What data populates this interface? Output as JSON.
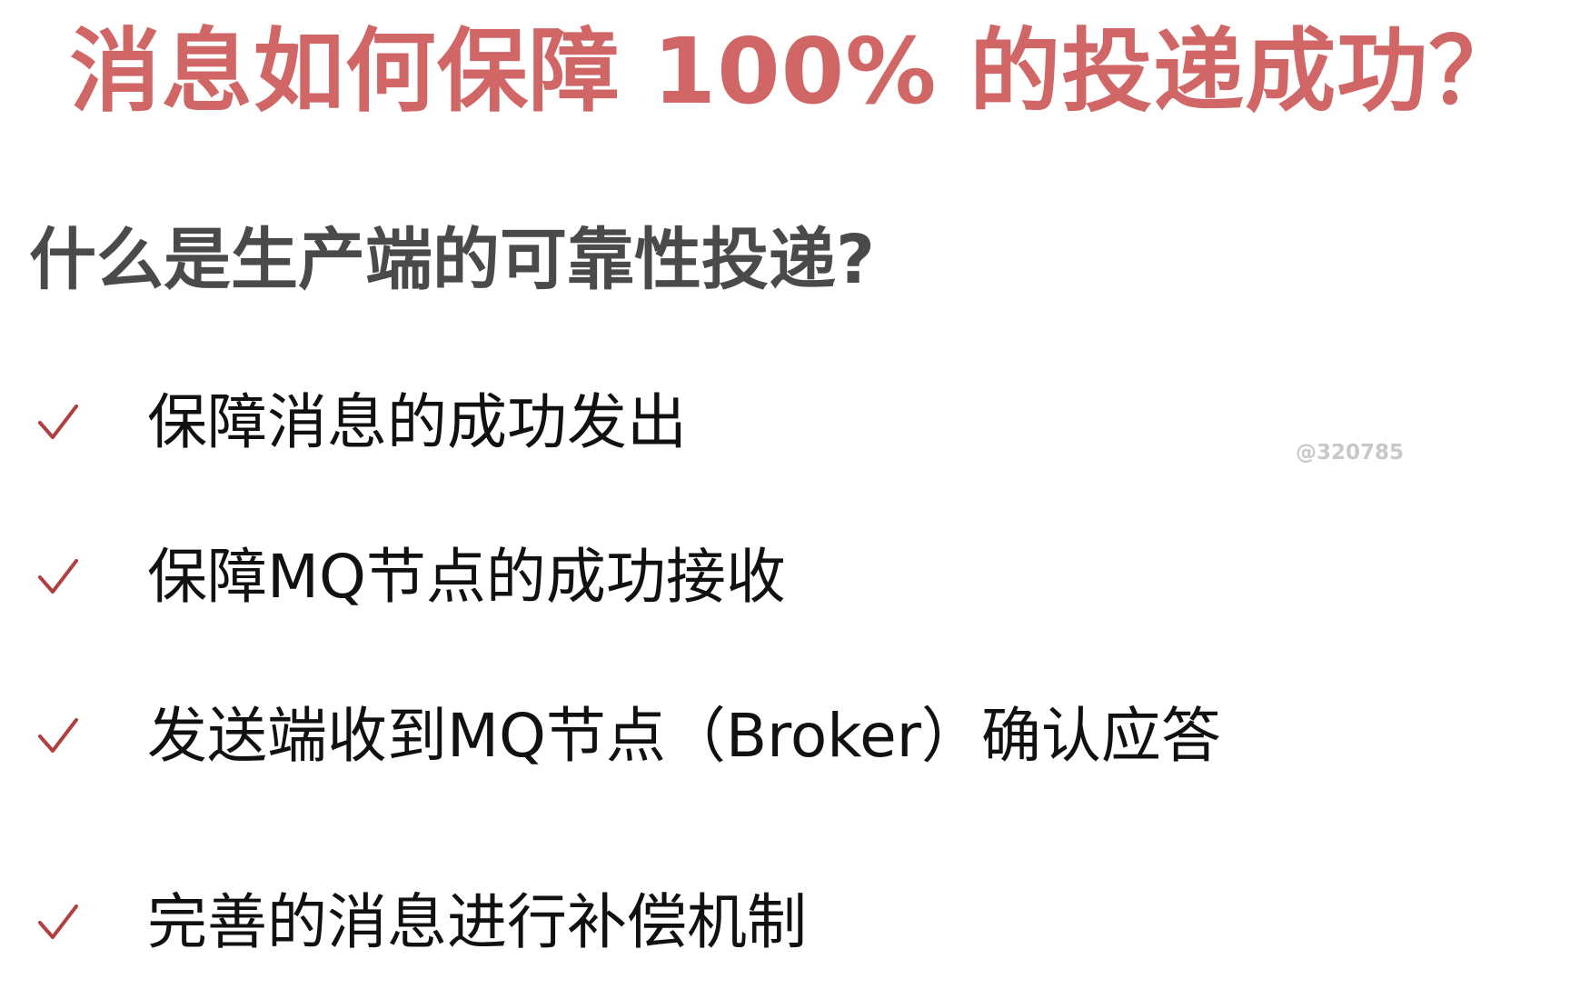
{
  "slide": {
    "title": "消息如何保障 100% 的投递成功？",
    "subtitle": "什么是生产端的可靠性投递?",
    "watermark": "@320785",
    "items": [
      {
        "text": "保障消息的成功发出",
        "icon": "check-icon"
      },
      {
        "text": "保障MQ节点的成功接收",
        "icon": "check-icon"
      },
      {
        "text": "发送端收到MQ节点（Broker）确认应答",
        "icon": "check-icon"
      },
      {
        "text": "完善的消息进行补偿机制",
        "icon": "check-icon"
      }
    ]
  },
  "colors": {
    "title": "#d06666",
    "subtitle": "#4a4a4a",
    "check": "#b04040",
    "text": "#111111",
    "watermark": "#c8c8c8"
  }
}
